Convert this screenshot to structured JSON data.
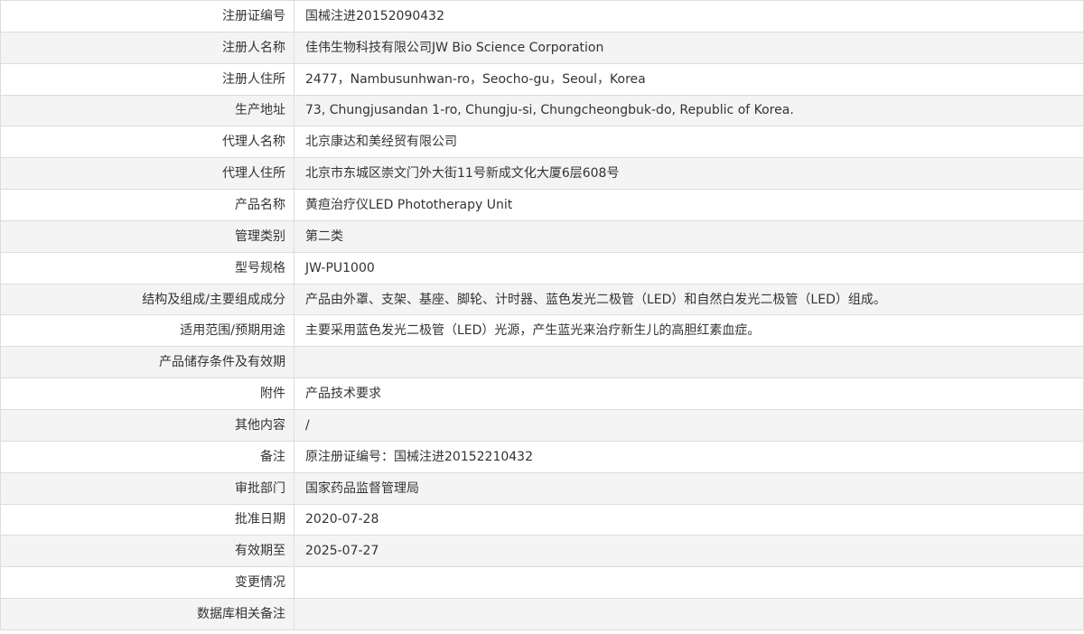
{
  "rows": [
    {
      "label": "注册证编号",
      "value": "国械注进20152090432"
    },
    {
      "label": "注册人名称",
      "value": "佳伟生物科技有限公司JW Bio Science Corporation"
    },
    {
      "label": "注册人住所",
      "value": "2477，Nambusunhwan-ro，Seocho-gu，Seoul，Korea"
    },
    {
      "label": "生产地址",
      "value": "73, Chungjusandan 1-ro, Chungju-si, Chungcheongbuk-do, Republic of Korea."
    },
    {
      "label": "代理人名称",
      "value": "北京康达和美经贸有限公司"
    },
    {
      "label": "代理人住所",
      "value": "北京市东城区崇文门外大街11号新成文化大厦6层608号"
    },
    {
      "label": "产品名称",
      "value": "黄疸治疗仪LED Phototherapy Unit"
    },
    {
      "label": "管理类别",
      "value": "第二类"
    },
    {
      "label": "型号规格",
      "value": "JW-PU1000"
    },
    {
      "label": "结构及组成/主要组成成分",
      "value": "产品由外罩、支架、基座、脚轮、计时器、蓝色发光二极管（LED）和自然白发光二极管（LED）组成。"
    },
    {
      "label": "适用范围/预期用途",
      "value": "主要采用蓝色发光二极管（LED）光源，产生蓝光来治疗新生儿的高胆红素血症。"
    },
    {
      "label": "产品储存条件及有效期",
      "value": ""
    },
    {
      "label": "附件",
      "value": "产品技术要求"
    },
    {
      "label": "其他内容",
      "value": "/"
    },
    {
      "label": "备注",
      "value": "原注册证编号：国械注进20152210432"
    },
    {
      "label": "审批部门",
      "value": "国家药品监督管理局"
    },
    {
      "label": "批准日期",
      "value": "2020-07-28"
    },
    {
      "label": "有效期至",
      "value": "2025-07-27"
    },
    {
      "label": "变更情况",
      "value": ""
    },
    {
      "label": "数据库相关备注",
      "value": ""
    }
  ]
}
